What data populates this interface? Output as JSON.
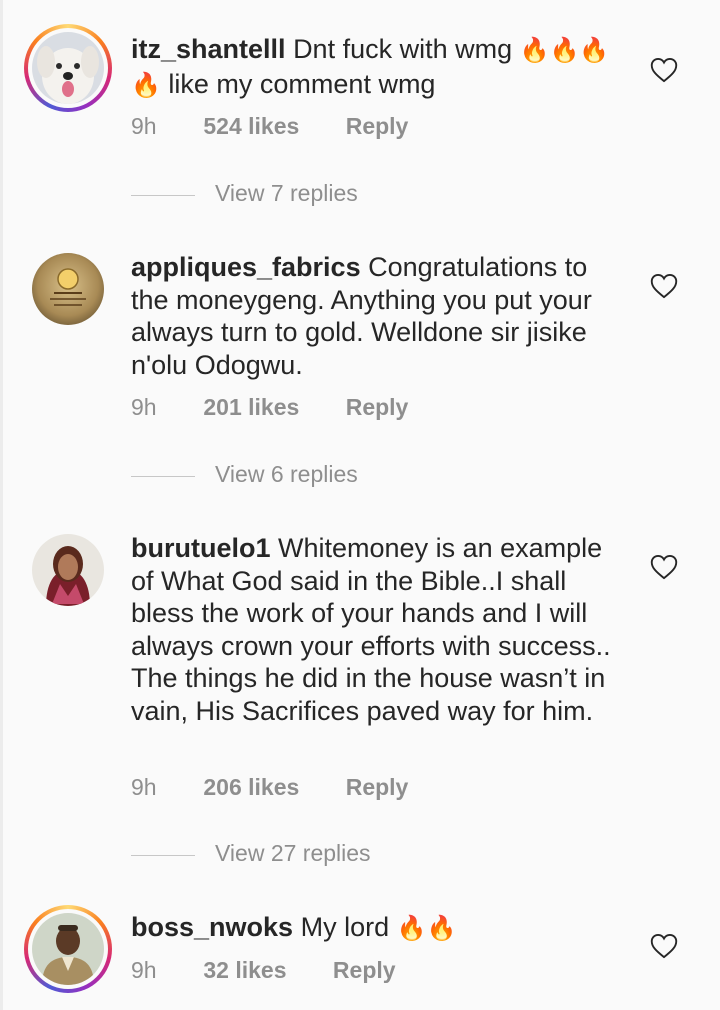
{
  "comments": [
    {
      "username": "itz_shantelll",
      "text": "Dnt fuck with wmg",
      "text_after": "like my comment wmg",
      "time": "9h",
      "likes": "524 likes",
      "reply": "Reply",
      "view_replies": "View 7 replies",
      "avatar": "white-dog-avatar"
    },
    {
      "username": "appliques_fabrics",
      "text": "Congratulations to the moneygeng. Anything you put your always turn to gold. Welldone sir jisike n'olu Odogwu.",
      "time": "9h",
      "likes": "201 likes",
      "reply": "Reply",
      "view_replies": "View 6 replies",
      "avatar": "gold-logo-avatar"
    },
    {
      "username": "burutuelo1",
      "text": "Whitemoney is an example of What God said in the Bible..I shall bless the work of your hands and I will always crown your efforts with success.. The things he did in the house wasn’t in vain, His Sacrifices paved way for him.",
      "time": "9h",
      "likes": "206 likes",
      "reply": "Reply",
      "view_replies": "View 27 replies",
      "avatar": "woman-portrait-avatar"
    },
    {
      "username": "boss_nwoks",
      "text": "My lord",
      "time": "9h",
      "likes": "32 likes",
      "reply": "Reply",
      "avatar": "man-portrait-avatar"
    }
  ],
  "emoji": {
    "fire": "🔥"
  },
  "colors": {
    "story_ring": "#d62976",
    "meta_text": "#8e8e8e",
    "background": "#fafafa"
  }
}
